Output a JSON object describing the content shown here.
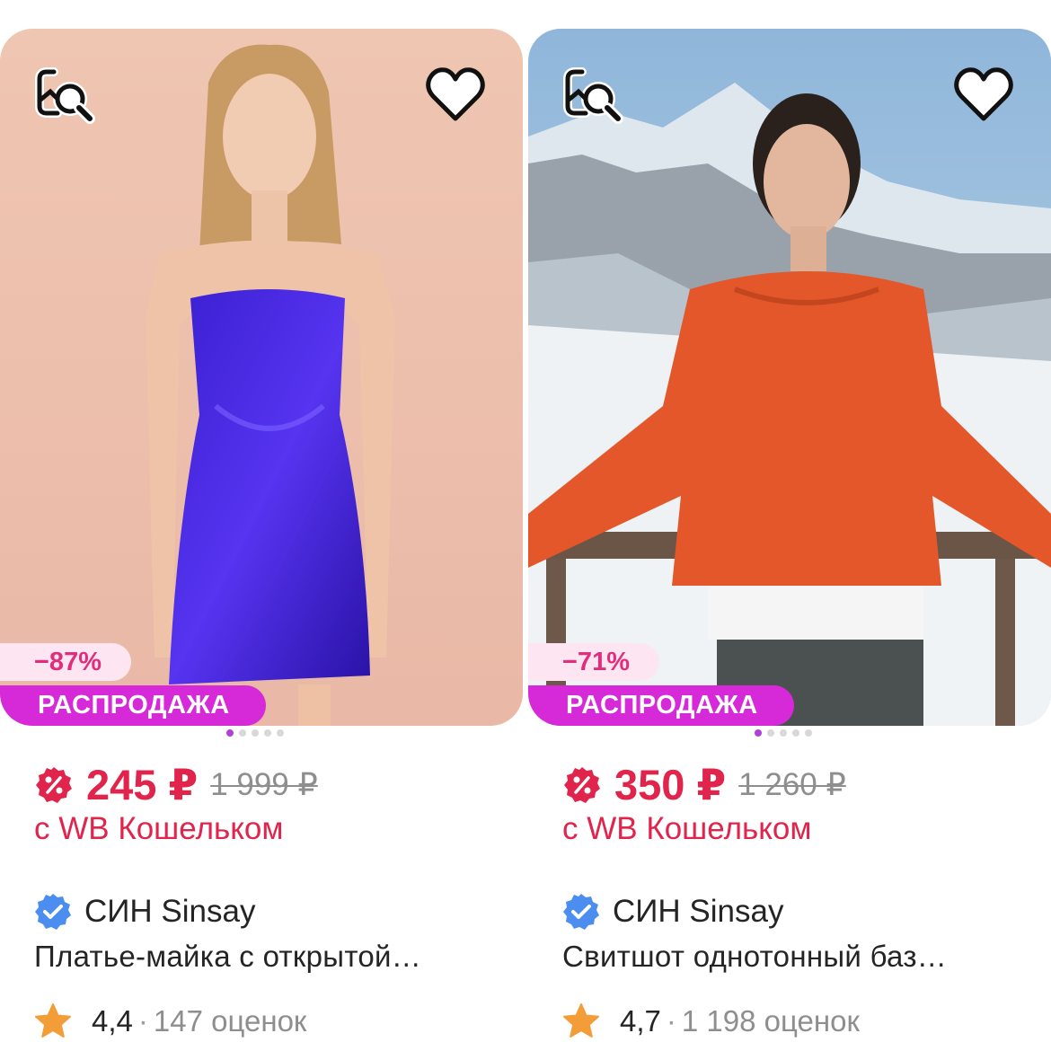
{
  "cards": [
    {
      "discount": "−87%",
      "sale_label": "РАСПРОДАЖА",
      "price_current": "245 ₽",
      "price_old": "1 999 ₽",
      "wallet_label": "с WB Кошельком",
      "brand": "СИН Sinsay",
      "name": "Платье-майка с открытой…",
      "rating": "4,4",
      "separator": "·",
      "reviews": "147 оценок",
      "gallery": {
        "count": 5,
        "active": 1
      }
    },
    {
      "discount": "−71%",
      "sale_label": "РАСПРОДАЖА",
      "price_current": "350 ₽",
      "price_old": "1 260 ₽",
      "wallet_label": "с WB Кошельком",
      "brand": "СИН Sinsay",
      "name": "Свитшот однотонный баз…",
      "rating": "4,7",
      "separator": "·",
      "reviews": "1 198 оценок",
      "gallery": {
        "count": 5,
        "active": 1
      }
    }
  ],
  "icons": {
    "find_similar": "image-search-icon",
    "favorite": "heart-icon",
    "wallet_discount": "wallet-discount-icon",
    "verified": "verified-check-icon",
    "rating": "star-icon"
  },
  "colors": {
    "price": "#e1244c",
    "sale_badge": "#d62ad8",
    "discount_badge_bg": "#fde6f1",
    "discount_badge_text": "#e12e7c",
    "verified": "#4b8ef0",
    "star": "#f29d38",
    "gallery_dot_active": "#b040d8"
  }
}
